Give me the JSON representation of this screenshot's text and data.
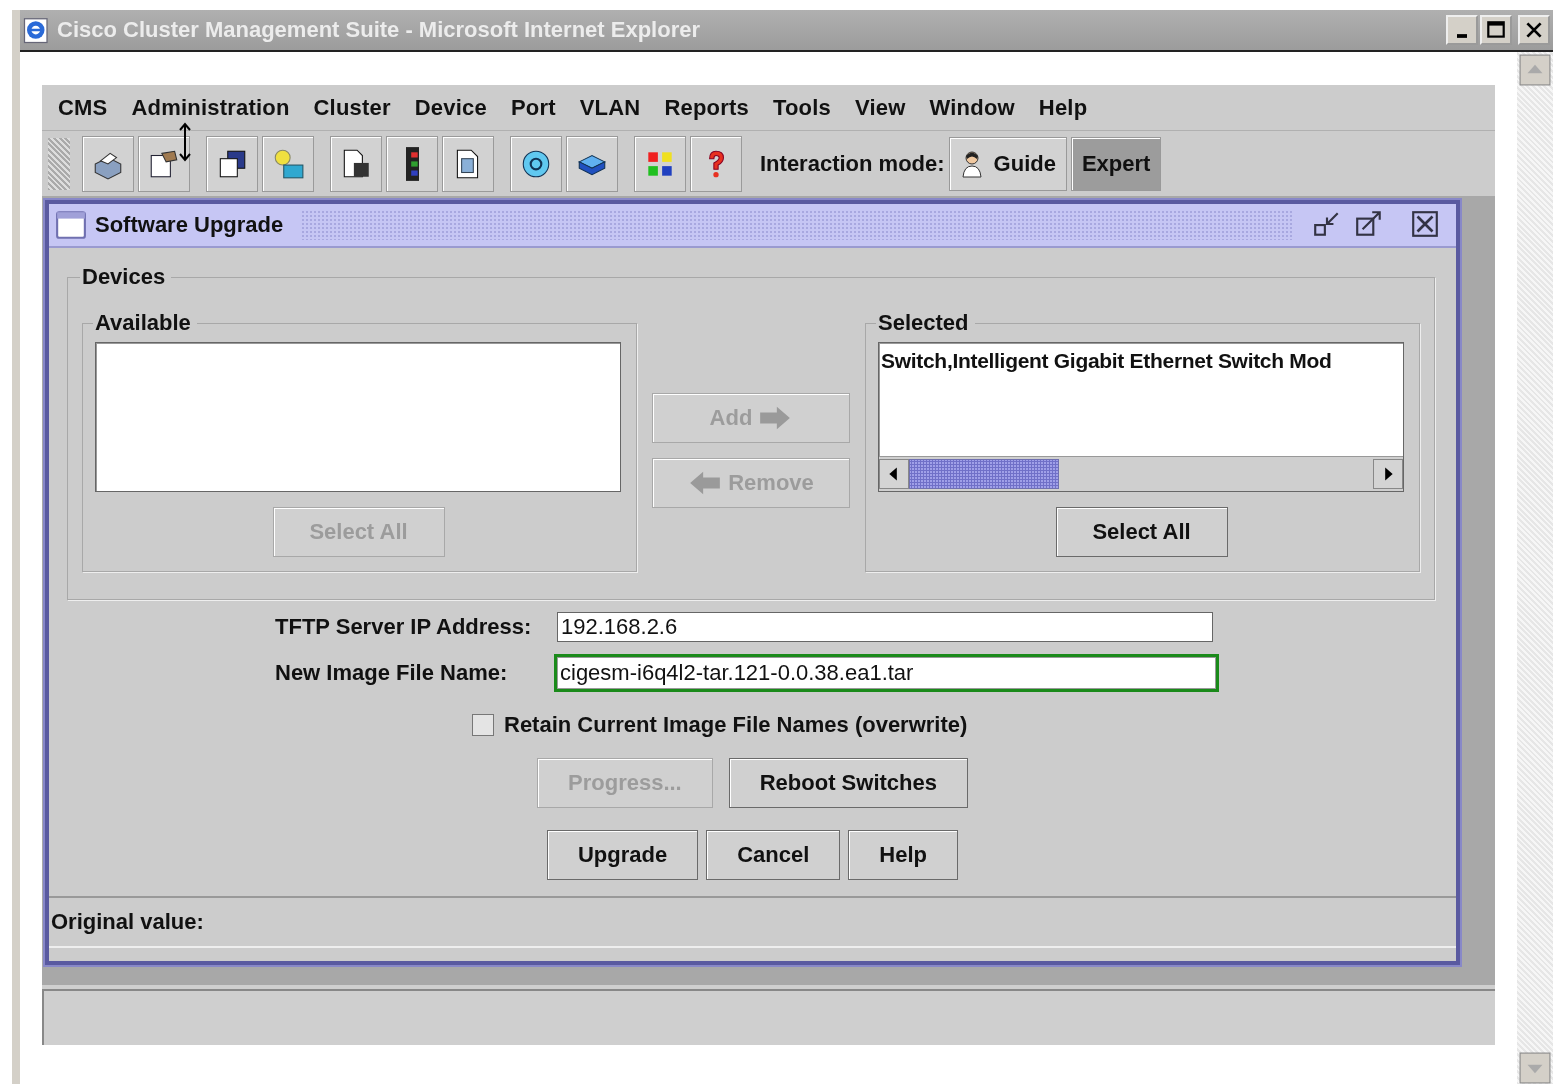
{
  "window": {
    "title": "Cisco Cluster Management Suite - Microsoft Internet Explorer"
  },
  "menu": [
    {
      "label": "CMS"
    },
    {
      "label": "Administration"
    },
    {
      "label": "Cluster"
    },
    {
      "label": "Device"
    },
    {
      "label": "Port"
    },
    {
      "label": "VLAN"
    },
    {
      "label": "Reports"
    },
    {
      "label": "Tools"
    },
    {
      "label": "View"
    },
    {
      "label": "Window"
    },
    {
      "label": "Help"
    }
  ],
  "interaction_mode": {
    "label": "Interaction mode:",
    "modes": [
      {
        "label": "Guide",
        "kind": "guide",
        "selected": false
      },
      {
        "label": "Expert",
        "kind": "expert",
        "selected": true
      }
    ]
  },
  "dialog": {
    "title": "Software Upgrade",
    "devices": {
      "title": "Devices",
      "available": {
        "title": "Available",
        "select_all": {
          "label": "Select All",
          "disabled": true
        }
      },
      "transfer_buttons": [
        {
          "label": "Add",
          "kind": "add",
          "disabled": true
        },
        {
          "label": "Remove",
          "kind": "remove",
          "disabled": true
        }
      ],
      "selected": {
        "title": "Selected",
        "items": [
          "Switch,Intelligent Gigabit Ethernet Switch Mod"
        ],
        "select_all": {
          "label": "Select All",
          "disabled": false
        }
      }
    },
    "fields": [
      {
        "label": "TFTP Server IP Address:",
        "value": "192.168.2.6",
        "focused": false
      },
      {
        "label": "New Image File Name:",
        "value": "cigesm-i6q4l2-tar.121-0.0.38.ea1.tar",
        "focused": true
      }
    ],
    "retain_checkbox": {
      "label": "Retain Current Image File Names (overwrite)",
      "checked": false
    },
    "action_buttons": [
      {
        "label": "Progress...",
        "disabled": true
      },
      {
        "label": "Reboot Switches",
        "disabled": false
      }
    ],
    "dialog_buttons": [
      {
        "label": "Upgrade"
      },
      {
        "label": "Cancel"
      },
      {
        "label": "Help"
      }
    ],
    "status": "Original value:"
  }
}
